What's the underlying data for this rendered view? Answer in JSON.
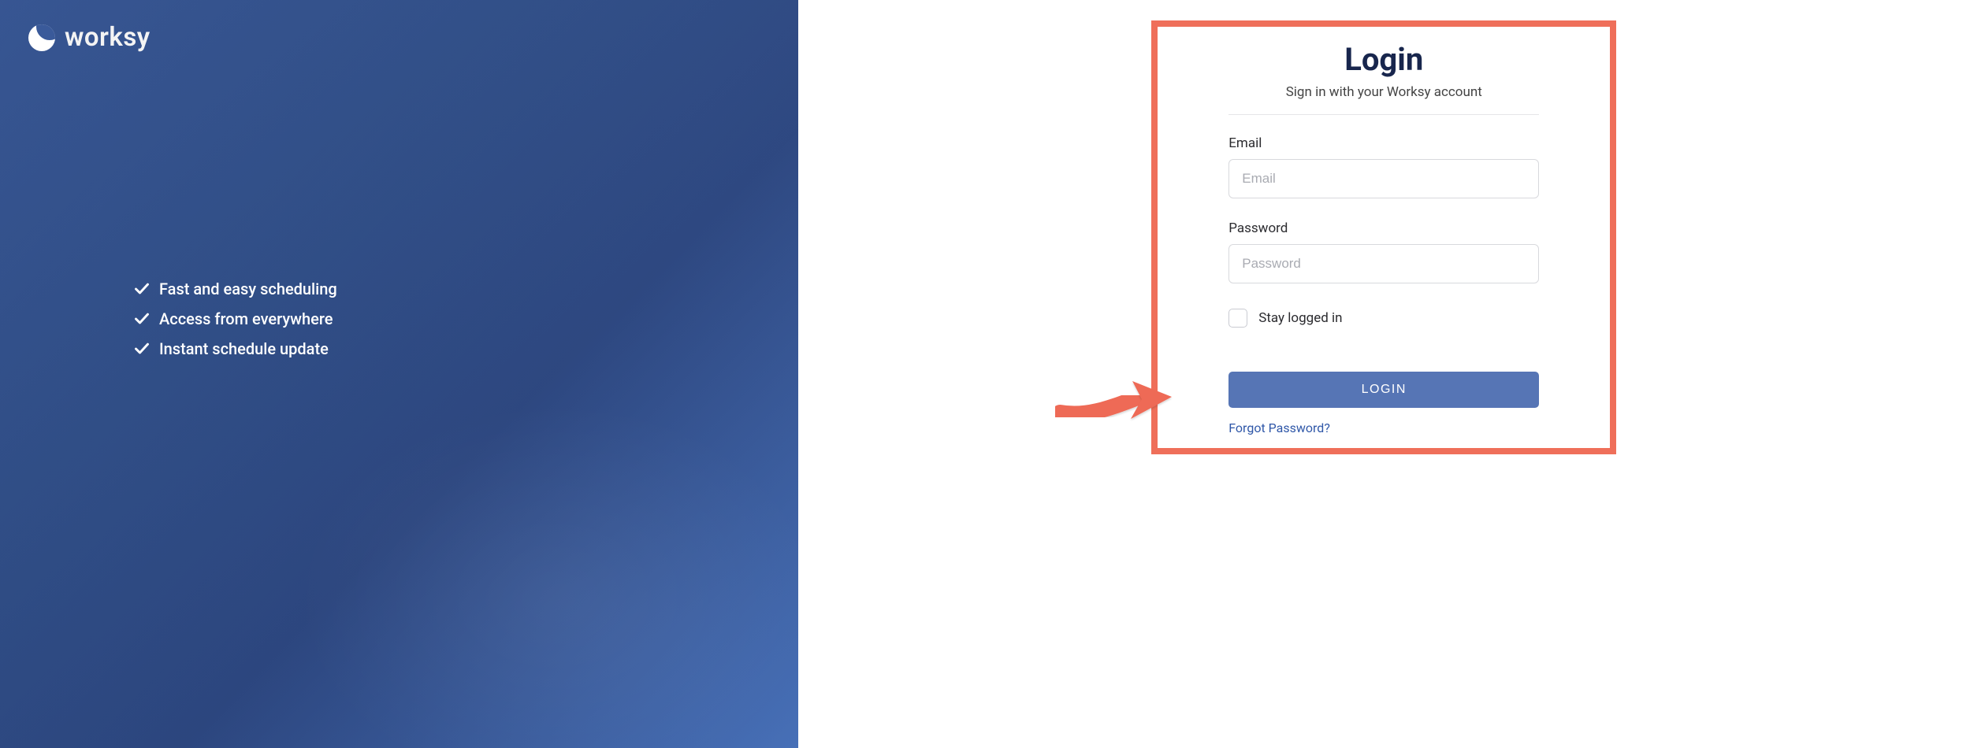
{
  "brand": {
    "name": "worksy"
  },
  "features": [
    "Fast and easy scheduling",
    "Access from everywhere",
    "Instant schedule update"
  ],
  "login": {
    "title": "Login",
    "subtitle": "Sign in with your Worksy account",
    "email_label": "Email",
    "email_placeholder": "Email",
    "password_label": "Password",
    "password_placeholder": "Password",
    "stay_label": "Stay logged in",
    "button_label": "LOGIN",
    "forgot_label": "Forgot Password?"
  },
  "colors": {
    "highlight_border": "#ef6f5a",
    "primary_button": "#5675b5",
    "title_navy": "#18264d"
  }
}
